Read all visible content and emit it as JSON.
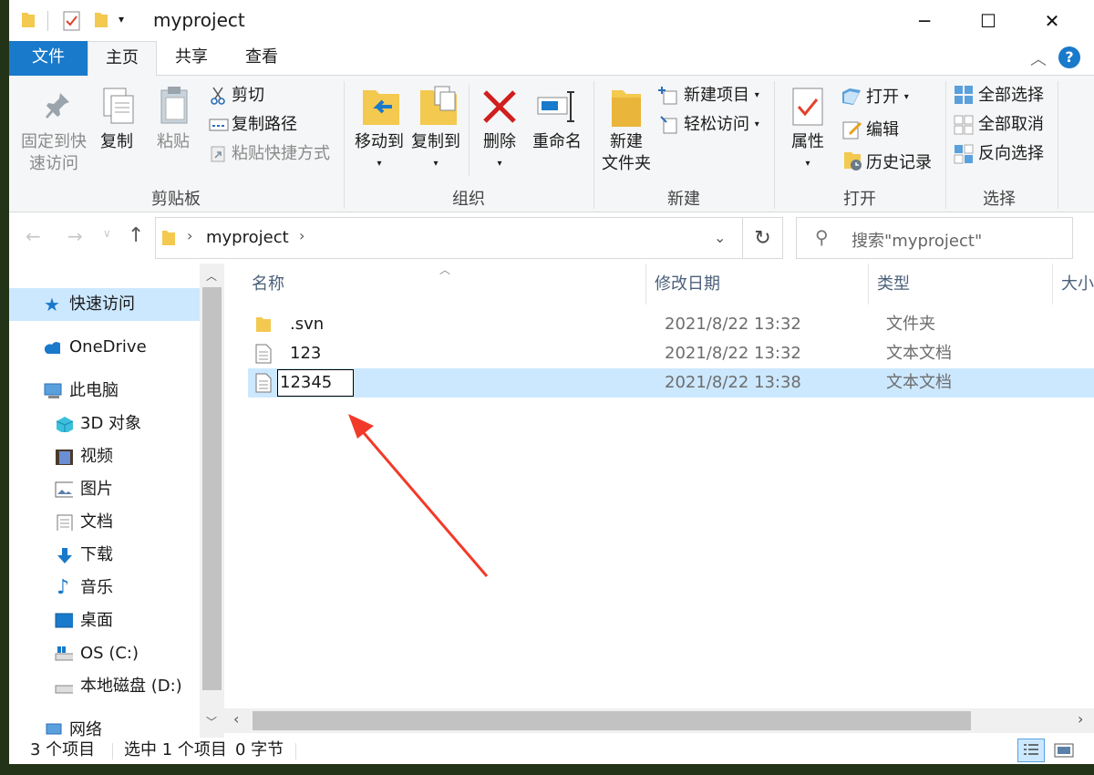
{
  "window": {
    "title": "myproject"
  },
  "tabs": {
    "file": "文件",
    "home": "主页",
    "share": "共享",
    "view": "查看"
  },
  "ribbon": {
    "clipboard": {
      "pin": "固定到快",
      "pin2": "速访问",
      "copy": "复制",
      "paste": "粘贴",
      "cut": "剪切",
      "copy_path": "复制路径",
      "paste_shortcut": "粘贴快捷方式",
      "label": "剪贴板"
    },
    "organize": {
      "move_to": "移动到",
      "copy_to": "复制到",
      "delete": "删除",
      "rename": "重命名",
      "label": "组织"
    },
    "new": {
      "new_folder": "新建",
      "new_folder2": "文件夹",
      "new_item": "新建项目",
      "easy_access": "轻松访问",
      "label": "新建"
    },
    "open": {
      "properties": "属性",
      "open": "打开",
      "edit": "编辑",
      "history": "历史记录",
      "label": "打开"
    },
    "select": {
      "select_all": "全部选择",
      "select_none": "全部取消",
      "invert": "反向选择",
      "label": "选择"
    }
  },
  "address": {
    "path": "myproject",
    "search_placeholder": "搜索\"myproject\""
  },
  "nav": {
    "quick_access": "快速访问",
    "onedrive": "OneDrive",
    "this_pc": "此电脑",
    "objects3d": "3D 对象",
    "videos": "视频",
    "pictures": "图片",
    "documents": "文档",
    "downloads": "下载",
    "music": "音乐",
    "desktop": "桌面",
    "os_c": "OS (C:)",
    "local_d": "本地磁盘 (D:)",
    "network": "网络"
  },
  "columns": {
    "name": "名称",
    "modified": "修改日期",
    "type": "类型",
    "size": "大小"
  },
  "files": [
    {
      "name": ".svn",
      "modified": "2021/8/22 13:32",
      "type": "文件夹",
      "icon": "folder-icon"
    },
    {
      "name": "123",
      "modified": "2021/8/22 13:32",
      "type": "文本文档",
      "icon": "text-file-icon"
    },
    {
      "name": "12345",
      "modified": "2021/8/22 13:38",
      "type": "文本文档",
      "icon": "text-file-icon"
    }
  ],
  "status": {
    "count": "3 个项目",
    "selected": "选中 1 个项目",
    "size": "0 字节"
  },
  "colors": {
    "accent": "#1979ca",
    "selection": "#cce8ff",
    "arrow": "#f23a2a"
  }
}
